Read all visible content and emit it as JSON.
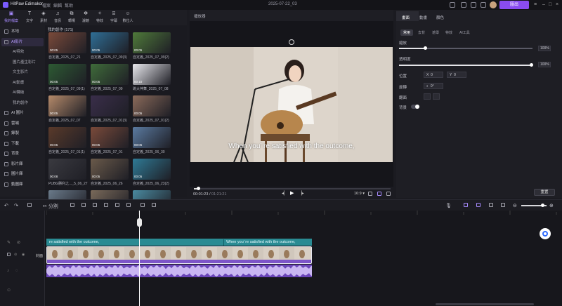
{
  "app": {
    "name": "HitPaw Edimakor",
    "menus": [
      "檔案",
      "編輯",
      "幫助"
    ],
    "project_title": "2025-07-22_03",
    "export_label": "匯出"
  },
  "tool_tabs": [
    {
      "label": "我的檔案",
      "icon": "folder-icon",
      "active": true
    },
    {
      "label": "文字",
      "icon": "text-icon",
      "active": false
    },
    {
      "label": "素材",
      "icon": "sticker-icon",
      "active": false
    },
    {
      "label": "音訊",
      "icon": "music-icon",
      "active": false
    },
    {
      "label": "轉場",
      "icon": "transition-icon",
      "active": false
    },
    {
      "label": "濾鏡",
      "icon": "filter-icon",
      "active": false
    },
    {
      "label": "特效",
      "icon": "effect-icon",
      "active": false
    },
    {
      "label": "字幕",
      "icon": "subtitle-icon",
      "active": false
    },
    {
      "label": "數位人",
      "icon": "avatar-icon",
      "active": false
    }
  ],
  "sidebar": {
    "items": [
      {
        "label": "本地",
        "sub": false,
        "active": false
      },
      {
        "label": "AI影片",
        "sub": false,
        "active": true
      },
      {
        "label": "AI特效",
        "sub": true,
        "active": false
      },
      {
        "label": "圖片產生影片",
        "sub": true,
        "active": false
      },
      {
        "label": "文生影片",
        "sub": true,
        "active": false
      },
      {
        "label": "AI動畫",
        "sub": true,
        "active": false
      },
      {
        "label": "AI轉繪",
        "sub": true,
        "active": false
      },
      {
        "label": "我的創作",
        "sub": true,
        "active": false
      },
      {
        "label": "AI 圖片",
        "sub": false,
        "active": false
      },
      {
        "label": "雲端",
        "sub": false,
        "active": false
      },
      {
        "label": "錄製",
        "sub": false,
        "active": false
      },
      {
        "label": "下載",
        "sub": false,
        "active": false
      },
      {
        "label": "背景",
        "sub": false,
        "active": false
      },
      {
        "label": "影片庫",
        "sub": false,
        "active": false
      },
      {
        "label": "圖片庫",
        "sub": false,
        "active": false
      },
      {
        "label": "動圖庫",
        "sub": false,
        "active": false
      }
    ]
  },
  "media": {
    "title": "我的創作 (171)",
    "items": [
      {
        "name": "自定義_2025_07_21",
        "duration": "00:05",
        "color": "#7a4a3a"
      },
      {
        "name": "自定義_2025_07_09(3)",
        "duration": "00:05",
        "color": "#2f6e95"
      },
      {
        "name": "自定義_2025_07_09(2)",
        "duration": "00:05",
        "color": "#4f7a3a"
      },
      {
        "name": "自定義_2025_07_09(1)",
        "duration": "00:05",
        "color": "#2d5a33"
      },
      {
        "name": "自定義_2025_07_09",
        "duration": "00:05",
        "color": "#3f6b3a"
      },
      {
        "name": "跳大神舞_2025_07_08",
        "duration": "00:10",
        "color": "#e9e9ee"
      },
      {
        "name": "自定義_2025_07_07",
        "duration": "00:05",
        "color": "#b58a6a"
      },
      {
        "name": "自定義_2025_07_01(3)",
        "duration": "",
        "color": "#3a2e4a"
      },
      {
        "name": "自定義_2025_07_01(2)",
        "duration": "00:05",
        "color": "#8a6a5a"
      },
      {
        "name": "自定義_2025_07_01(1)",
        "duration": "00:05",
        "color": "#5a3a2a"
      },
      {
        "name": "自定義_2025_07_01",
        "duration": "00:05",
        "color": "#7a4a3a"
      },
      {
        "name": "自定義_2025_06_30",
        "duration": "00:05",
        "color": "#5a7aa0"
      },
      {
        "name": "PUBG勝利之..._5_06_27",
        "duration": "00:08",
        "color": "#3a3a40"
      },
      {
        "name": "自定義_2025_06_26",
        "duration": "00:05",
        "color": "#6a5a4a"
      },
      {
        "name": "自定義_2025_06_23(2)",
        "duration": "00:05",
        "color": "#2f7a95"
      },
      {
        "name": "",
        "duration": "",
        "color": "#6a7a8a"
      },
      {
        "name": "",
        "duration": "",
        "color": "#7a6a5a"
      },
      {
        "name": "",
        "duration": "",
        "color": "#4a8aa0"
      }
    ]
  },
  "preview": {
    "label": "播放器",
    "subtitle": "When you’  re satisfied with the outcome,",
    "current_time": "00:01:23",
    "total_time": "01:21:21",
    "ratio": "16:9",
    "progress": 0.02
  },
  "properties": {
    "tabs": [
      "畫面",
      "動畫",
      "顏色"
    ],
    "subtabs": [
      "常用",
      "去背",
      "遮罩",
      "特效",
      "AI工具"
    ],
    "scale_label": "縮放",
    "scale_value": "100%",
    "opacity_label": "透明度",
    "opacity_value": "100%",
    "position_label": "位置",
    "pos_x_label": "X",
    "pos_x": "0",
    "pos_y_label": "Y",
    "pos_y": "0",
    "rotate_label": "旋轉",
    "rotate_value": "0°",
    "flip_label": "翻面",
    "bg_label": "背景",
    "reset_label": "重置"
  },
  "timeline": {
    "split_label": "分割",
    "subtitle_clips": [
      "re satisfied with the outcome,",
      "When you’  re satisfied with the outcome,"
    ],
    "video_track_label": "封面"
  },
  "colors": {
    "accent": "#8a4cf0",
    "subtitle_track": "#2a8b93",
    "audio_track": "#6a45b8"
  }
}
